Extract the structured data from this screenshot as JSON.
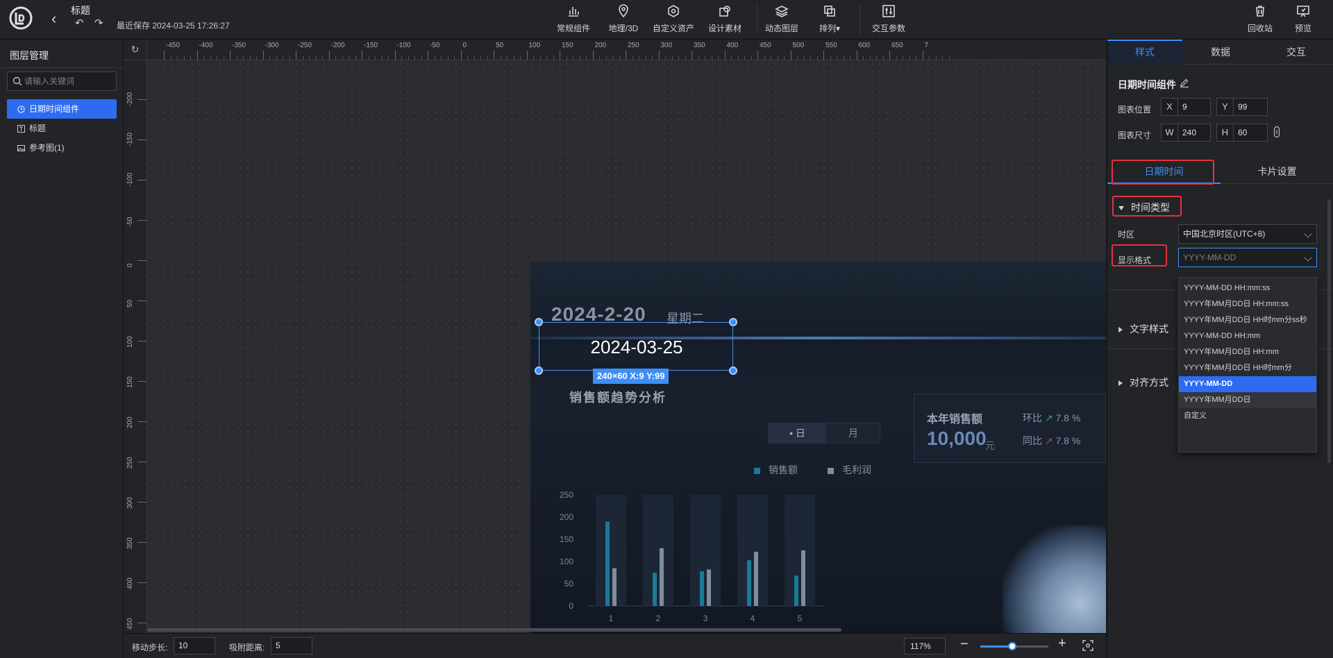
{
  "header": {
    "title": "标题",
    "save_time": "最近保存 2024-03-25 17:26:27",
    "toolbar": [
      {
        "label": "常规组件",
        "icon": "bar-chart-icon"
      },
      {
        "label": "地理/3D",
        "icon": "map-pin-icon"
      },
      {
        "label": "自定义资产",
        "icon": "hexagon-icon"
      },
      {
        "label": "设计素材",
        "icon": "material-icon"
      },
      {
        "label": "动态图层",
        "icon": "layers-icon"
      },
      {
        "label": "排列▾",
        "icon": "arrange-icon"
      },
      {
        "label": "交互参数",
        "icon": "sliders-icon"
      }
    ],
    "right_actions": [
      {
        "label": "回收站",
        "icon": "trash-icon"
      },
      {
        "label": "预览",
        "icon": "preview-icon"
      }
    ]
  },
  "left_panel": {
    "title": "图层管理",
    "search_placeholder": "请输入关键词",
    "layers": [
      {
        "label": "日期时间组件",
        "icon": "clock-icon",
        "active": true
      },
      {
        "label": "标题",
        "icon": "text-icon",
        "active": false
      },
      {
        "label": "参考图(1)",
        "icon": "image-icon",
        "active": false
      }
    ]
  },
  "canvas": {
    "ruler_top": [
      "-450",
      "-400",
      "-350",
      "-300",
      "-250",
      "-200",
      "-150",
      "-100",
      "-50",
      "0",
      "50",
      "100",
      "150",
      "200",
      "250",
      "300",
      "350",
      "400",
      "450",
      "500",
      "550",
      "600",
      "650",
      "7"
    ],
    "ruler_left": [
      "-200",
      "-150",
      "-100",
      "-50",
      "0",
      "50",
      "100",
      "150",
      "200",
      "250",
      "300",
      "350",
      "400",
      "450"
    ],
    "selected_text": "2024-03-25",
    "selection_tag": "240×60   X:9 Y:99",
    "reference": {
      "date": "2024-2-20",
      "weekday": "星期二",
      "subtitle": "销售额趋势分析",
      "card_title": "本年销售额",
      "card_value": "10,000",
      "card_unit": "元",
      "ratio1_label": "环比",
      "ratio1_value": "7.8",
      "ratio2_label": "同比",
      "ratio2_value": "7.8",
      "pct": "%",
      "toggle_day": "• 日",
      "toggle_month": "月",
      "legend": [
        "销售额",
        "毛利润"
      ],
      "legend_colors": [
        "#1a7a99",
        "#7f8da0"
      ]
    }
  },
  "chart_data": {
    "type": "bar",
    "categories": [
      "1",
      "2",
      "3",
      "4",
      "5"
    ],
    "series": [
      {
        "name": "销售额",
        "values": [
          190,
          75,
          78,
          103,
          68
        ]
      },
      {
        "name": "毛利润",
        "values": [
          85,
          130,
          82,
          122,
          125
        ]
      }
    ],
    "ylim": [
      0,
      250
    ],
    "yticks": [
      "250",
      "200",
      "150",
      "100",
      "50",
      "0"
    ]
  },
  "bottom_bar": {
    "step_label": "移动步长:",
    "step_value": "10",
    "snap_label": "吸附距离:",
    "snap_value": "5",
    "zoom": "117%",
    "zoom_fraction": 0.47
  },
  "right_panel": {
    "tabs": [
      "样式",
      "数据",
      "交互"
    ],
    "component_name": "日期时间组件",
    "pos_label": "图表位置",
    "x_label": "X",
    "x_value": "9",
    "y_label": "Y",
    "y_value": "99",
    "size_label": "图表尺寸",
    "w_label": "W",
    "w_value": "240",
    "h_label": "H",
    "h_value": "60",
    "sub_tabs": [
      "日期时间",
      "卡片设置"
    ],
    "section_time_type": "时间类型",
    "timezone_label": "时区",
    "timezone_value": "中国北京时区(UTC+8)",
    "format_label": "显示格式",
    "format_placeholder": "YYYY-MM-DD",
    "format_options": [
      "YYYY-MM-DD HH:mm:ss",
      "YYYY年MM月DD日 HH:mm:ss",
      "YYYY年MM月DD日 HH时mm分ss秒",
      "YYYY-MM-DD HH:mm",
      "YYYY年MM月DD日 HH:mm",
      "YYYY年MM月DD日 HH时mm分",
      "YYYY-MM-DD",
      "YYYY年MM月DD日",
      "自定义"
    ],
    "format_selected_index": 6,
    "section_text_style": "文字样式",
    "section_align": "对齐方式"
  }
}
